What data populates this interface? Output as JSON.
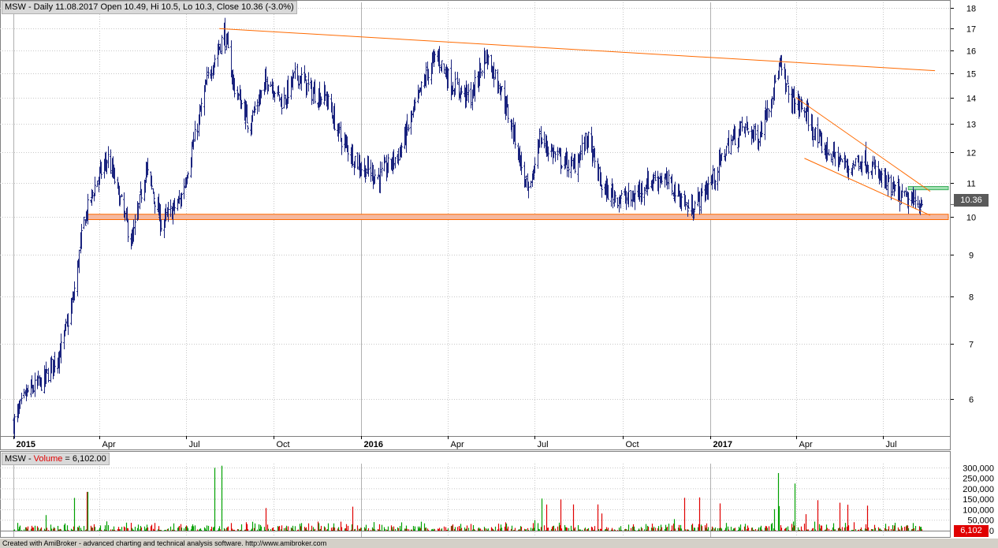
{
  "header": {
    "symbol": "MSW",
    "text": "MSW - Daily 11.08.2017 Open 10.49, Hi 10.5, Lo 10.3, Close 10.36 (-3.0%)"
  },
  "volume_header": {
    "prefix": "MSW - ",
    "label": "Volume",
    "suffix": " = 6,102.00"
  },
  "last_price_label": "10.36",
  "last_volume_label": "6,102",
  "volume_zero_label": "0",
  "footer": "Created with AmiBroker - advanced charting and technical analysis software. http://www.amibroker.com",
  "colors": {
    "price_bar": "#1a237e",
    "trendline": "#ff6a00",
    "support_fill": "#f4b8a0",
    "resistance_zone": "#9fe0b0",
    "volume_up": "#00a000",
    "volume_down": "#e00000",
    "grid": "#c8c8c8"
  },
  "chart_data": [
    {
      "type": "ohlc",
      "title": "MSW - Daily 11.08.2017 Open 10.49, Hi 10.5, Lo 10.3, Close 10.36 (-3.0%)",
      "y_scale": "log",
      "ylim": [
        5.4,
        18.3
      ],
      "y_ticks": [
        6,
        7,
        8,
        9,
        10,
        11,
        12,
        13,
        14,
        15,
        16,
        17,
        18
      ],
      "x_tick_labels": [
        "2015",
        "Apr",
        "Jul",
        "Oct",
        "2016",
        "Apr",
        "Jul",
        "Oct",
        "2017",
        "Apr",
        "Jul"
      ],
      "x_range": [
        "2015-01-01",
        "2017-09-08"
      ],
      "grid": true,
      "last": {
        "date": "2017-08-11",
        "open": 10.49,
        "high": 10.5,
        "low": 10.3,
        "close": 10.36,
        "change_pct": -3.0
      },
      "approx_close_path": [
        {
          "date": "2015-01-01",
          "close": 5.6
        },
        {
          "date": "2015-01-15",
          "close": 6.1
        },
        {
          "date": "2015-02-01",
          "close": 6.3
        },
        {
          "date": "2015-02-20",
          "close": 6.9
        },
        {
          "date": "2015-03-05",
          "close": 8.0
        },
        {
          "date": "2015-03-15",
          "close": 9.8
        },
        {
          "date": "2015-03-28",
          "close": 11.0
        },
        {
          "date": "2015-04-10",
          "close": 11.8
        },
        {
          "date": "2015-04-20",
          "close": 10.8
        },
        {
          "date": "2015-05-05",
          "close": 9.3
        },
        {
          "date": "2015-05-20",
          "close": 11.5
        },
        {
          "date": "2015-06-05",
          "close": 9.8
        },
        {
          "date": "2015-06-25",
          "close": 10.5
        },
        {
          "date": "2015-07-10",
          "close": 12.5
        },
        {
          "date": "2015-07-25",
          "close": 15.0
        },
        {
          "date": "2015-08-10",
          "close": 16.8
        },
        {
          "date": "2015-08-20",
          "close": 14.5
        },
        {
          "date": "2015-09-05",
          "close": 13.0
        },
        {
          "date": "2015-09-25",
          "close": 14.8
        },
        {
          "date": "2015-10-10",
          "close": 13.8
        },
        {
          "date": "2015-10-25",
          "close": 15.0
        },
        {
          "date": "2015-11-10",
          "close": 14.2
        },
        {
          "date": "2015-11-25",
          "close": 14.0
        },
        {
          "date": "2015-12-10",
          "close": 12.5
        },
        {
          "date": "2016-01-01",
          "close": 11.5
        },
        {
          "date": "2016-01-20",
          "close": 11.2
        },
        {
          "date": "2016-02-10",
          "close": 12.0
        },
        {
          "date": "2016-02-25",
          "close": 13.5
        },
        {
          "date": "2016-03-10",
          "close": 15.0
        },
        {
          "date": "2016-03-20",
          "close": 15.8
        },
        {
          "date": "2016-04-05",
          "close": 14.5
        },
        {
          "date": "2016-04-25",
          "close": 14.0
        },
        {
          "date": "2016-05-10",
          "close": 15.8
        },
        {
          "date": "2016-05-25",
          "close": 14.5
        },
        {
          "date": "2016-06-10",
          "close": 12.5
        },
        {
          "date": "2016-06-25",
          "close": 10.5
        },
        {
          "date": "2016-07-05",
          "close": 12.5
        },
        {
          "date": "2016-07-25",
          "close": 11.8
        },
        {
          "date": "2016-08-10",
          "close": 11.5
        },
        {
          "date": "2016-08-25",
          "close": 12.5
        },
        {
          "date": "2016-09-10",
          "close": 10.8
        },
        {
          "date": "2016-09-25",
          "close": 10.6
        },
        {
          "date": "2016-10-10",
          "close": 10.5
        },
        {
          "date": "2016-10-25",
          "close": 11.0
        },
        {
          "date": "2016-11-10",
          "close": 11.2
        },
        {
          "date": "2016-11-25",
          "close": 10.8
        },
        {
          "date": "2016-12-10",
          "close": 10.2
        },
        {
          "date": "2016-12-20",
          "close": 10.5
        },
        {
          "date": "2017-01-05",
          "close": 11.2
        },
        {
          "date": "2017-01-20",
          "close": 12.3
        },
        {
          "date": "2017-02-05",
          "close": 12.9
        },
        {
          "date": "2017-02-20",
          "close": 12.5
        },
        {
          "date": "2017-03-05",
          "close": 14.0
        },
        {
          "date": "2017-03-15",
          "close": 15.3
        },
        {
          "date": "2017-03-25",
          "close": 14.0
        },
        {
          "date": "2017-04-10",
          "close": 13.5
        },
        {
          "date": "2017-04-25",
          "close": 12.3
        },
        {
          "date": "2017-05-10",
          "close": 11.9
        },
        {
          "date": "2017-05-25",
          "close": 11.5
        },
        {
          "date": "2017-06-10",
          "close": 11.8
        },
        {
          "date": "2017-06-25",
          "close": 11.3
        },
        {
          "date": "2017-07-10",
          "close": 10.8
        },
        {
          "date": "2017-07-25",
          "close": 10.5
        },
        {
          "date": "2017-08-11",
          "close": 10.36
        }
      ],
      "annotations": [
        {
          "type": "trendline",
          "from": {
            "date": "2015-08-05",
            "price": 17.0
          },
          "to": {
            "date": "2017-08-25",
            "price": 15.1
          }
        },
        {
          "type": "trendline",
          "from": {
            "date": "2017-04-01",
            "price": 14.0
          },
          "to": {
            "date": "2017-08-20",
            "price": 10.75
          }
        },
        {
          "type": "trendline",
          "from": {
            "date": "2017-04-10",
            "price": 11.8
          },
          "to": {
            "date": "2017-08-20",
            "price": 10.05
          }
        },
        {
          "type": "zone",
          "from_date": "2015-03-20",
          "to_date": "2017-09-08",
          "low": 9.93,
          "high": 10.08
        },
        {
          "type": "zone",
          "from_date": "2017-07-28",
          "to_date": "2017-09-08",
          "low": 10.8,
          "high": 10.9
        }
      ]
    },
    {
      "type": "bar",
      "title": "MSW - Volume = 6,102.00",
      "ylim": [
        0,
        320000
      ],
      "y_tick_labels": [
        "50,000",
        "100,000",
        "150,000",
        "200,000",
        "250,000",
        "300,000"
      ],
      "last_value": 6102,
      "notable_peaks": [
        {
          "date": "2015-03-20",
          "value": 185000
        },
        {
          "date": "2015-08-01",
          "value": 300000
        },
        {
          "date": "2015-08-08",
          "value": 310000
        },
        {
          "date": "2017-03-12",
          "value": 275000
        },
        {
          "date": "2017-04-01",
          "value": 225000
        }
      ]
    }
  ]
}
